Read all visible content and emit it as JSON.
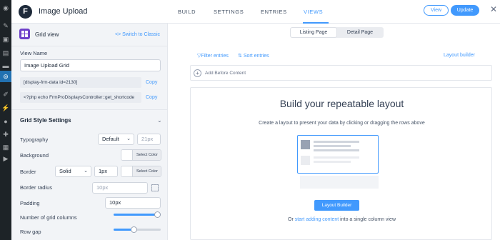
{
  "app": {
    "title": "Image Upload",
    "logo_letter": "F"
  },
  "tabs": [
    {
      "label": "BUILD",
      "active": false
    },
    {
      "label": "SETTINGS",
      "active": false
    },
    {
      "label": "ENTRIES",
      "active": false
    },
    {
      "label": "VIEWS",
      "active": true
    }
  ],
  "header": {
    "view_label": "View",
    "update_label": "Update",
    "close_glyph": "✕"
  },
  "sidebar": {
    "panel_title": "Grid view",
    "switch_label": "<> Switch to Classic",
    "view_name_label": "View Name",
    "view_name_value": "Image Upload Grid",
    "shortcode_1": "[display-frm-data id=2130]",
    "shortcode_2": "<?php echo FrmProDisplaysController::get_shortcode",
    "copy_label": "Copy",
    "section_title": "Grid Style Settings",
    "typography": {
      "label": "Typography",
      "font_value": "Default",
      "size_placeholder": "21px"
    },
    "background": {
      "label": "Background",
      "button": "Select Color"
    },
    "border": {
      "label": "Border",
      "style_value": "Solid",
      "width_value": "1px",
      "button": "Select Color"
    },
    "border_radius": {
      "label": "Border radius",
      "placeholder": "10px"
    },
    "padding": {
      "label": "Padding",
      "value": "10px"
    },
    "grid_columns": {
      "label": "Number of grid columns",
      "level": 1
    },
    "row_gap": {
      "label": "Row gap",
      "level": 0.42
    }
  },
  "main": {
    "segments": [
      "Listing Page",
      "Detail Page"
    ],
    "active_segment": 0,
    "filter_label": "Filter entries",
    "sort_label": "Sort entries",
    "layout_builder_link": "Layout builder",
    "add_before": "Add Before Content",
    "big_title": "Build your repeatable layout",
    "subtitle": "Create a layout to present your data by clicking or dragging the rows above",
    "layout_button": "Layout Builder",
    "or_prefix": "Or ",
    "or_link": "start adding content",
    "or_suffix": " into a single column view"
  },
  "icons": [
    "wp-dashboard-icon",
    "pin-icon",
    "media-icon",
    "pages-icon",
    "comments-icon",
    "formidable-icon",
    "appearance-icon",
    "plugins-icon",
    "users-icon",
    "tools-icon",
    "settings-icon",
    "play-icon"
  ],
  "colors": {
    "accent": "#4199fd",
    "wp_admin": "#1d2327",
    "grid_icon": "#6e40c9"
  }
}
